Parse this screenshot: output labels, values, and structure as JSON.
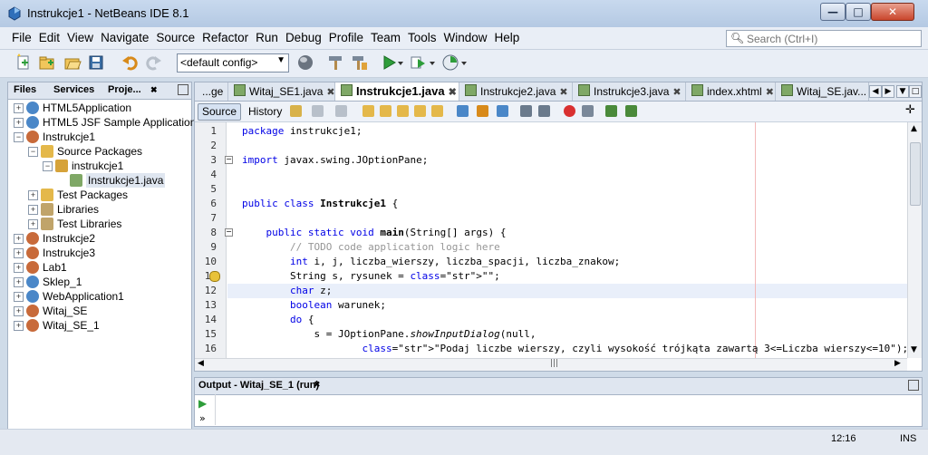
{
  "window": {
    "title": "Instrukcje1 - NetBeans IDE 8.1",
    "min_glyph": "—",
    "max_glyph": "□",
    "close_glyph": "✕"
  },
  "menu": [
    "File",
    "Edit",
    "View",
    "Navigate",
    "Source",
    "Refactor",
    "Run",
    "Debug",
    "Profile",
    "Team",
    "Tools",
    "Window",
    "Help"
  ],
  "search": {
    "placeholder": "Search (Ctrl+I)"
  },
  "toolbar": {
    "config": "<default config>"
  },
  "left_panel": {
    "tabs": [
      "Files",
      "Services",
      "Proje..."
    ],
    "close_glyph": "✖",
    "tree": [
      {
        "label": "HTML5Application",
        "depth": 0,
        "toggle": "+",
        "icon": "globe-icon"
      },
      {
        "label": "HTML5 JSF Sample Application",
        "depth": 0,
        "toggle": "+",
        "icon": "globe-icon"
      },
      {
        "label": "Instrukcje1",
        "depth": 0,
        "toggle": "−",
        "icon": "coffee-cup-icon"
      },
      {
        "label": "Source Packages",
        "depth": 1,
        "toggle": "−",
        "icon": "folder-icon"
      },
      {
        "label": "instrukcje1",
        "depth": 2,
        "toggle": "−",
        "icon": "package-icon"
      },
      {
        "label": "Instrukcje1.java",
        "depth": 3,
        "toggle": "",
        "icon": "java-file-icon",
        "selected": true
      },
      {
        "label": "Test Packages",
        "depth": 1,
        "toggle": "+",
        "icon": "folder-icon"
      },
      {
        "label": "Libraries",
        "depth": 1,
        "toggle": "+",
        "icon": "library-icon"
      },
      {
        "label": "Test Libraries",
        "depth": 1,
        "toggle": "+",
        "icon": "library-icon"
      },
      {
        "label": "Instrukcje2",
        "depth": 0,
        "toggle": "+",
        "icon": "coffee-cup-icon"
      },
      {
        "label": "Instrukcje3",
        "depth": 0,
        "toggle": "+",
        "icon": "coffee-cup-icon"
      },
      {
        "label": "Lab1",
        "depth": 0,
        "toggle": "+",
        "icon": "coffee-cup-icon"
      },
      {
        "label": "Sklep_1",
        "depth": 0,
        "toggle": "+",
        "icon": "globe-icon"
      },
      {
        "label": "WebApplication1",
        "depth": 0,
        "toggle": "+",
        "icon": "globe-icon"
      },
      {
        "label": "Witaj_SE",
        "depth": 0,
        "toggle": "+",
        "icon": "coffee-cup-icon"
      },
      {
        "label": "Witaj_SE_1",
        "depth": 0,
        "toggle": "+",
        "icon": "coffee-cup-icon"
      }
    ]
  },
  "editor": {
    "tabs": [
      {
        "label": "...ge",
        "active": false
      },
      {
        "label": "Witaj_SE1.java",
        "active": false
      },
      {
        "label": "Instrukcje1.java",
        "active": true
      },
      {
        "label": "Instrukcje2.java",
        "active": false
      },
      {
        "label": "Instrukcje3.java",
        "active": false
      },
      {
        "label": "index.xhtml",
        "active": false
      },
      {
        "label": "Witaj_SE.jav...",
        "active": false
      }
    ],
    "tab_close_glyph": "✖",
    "source_label": "Source",
    "history_label": "History",
    "lines": [
      {
        "n": "1",
        "code": "package instrukcje1;"
      },
      {
        "n": "2",
        "code": ""
      },
      {
        "n": "3",
        "code": "import javax.swing.JOptionPane;"
      },
      {
        "n": "4",
        "code": ""
      },
      {
        "n": "5",
        "code": ""
      },
      {
        "n": "6",
        "code": "public class Instrukcje1 {"
      },
      {
        "n": "7",
        "code": ""
      },
      {
        "n": "8",
        "code": "    public static void main(String[] args) {"
      },
      {
        "n": "9",
        "code": "        // TODO code application logic here"
      },
      {
        "n": "10",
        "code": "        int i, j, liczba_wierszy, liczba_spacji, liczba_znakow;"
      },
      {
        "n": "11",
        "code": "        String s, rysunek = \"\";"
      },
      {
        "n": "12",
        "code": "        char z;"
      },
      {
        "n": "13",
        "code": "        boolean warunek;"
      },
      {
        "n": "14",
        "code": "        do {"
      },
      {
        "n": "15",
        "code": "            s = JOptionPane.showInputDialog(null,"
      },
      {
        "n": "16",
        "code": "                    \"Podaj liczbe wierszy, czyli wysokość trójkąta zawartą 3<=Liczba wierszy<=10\");"
      }
    ],
    "hscroll_glyph": "|||"
  },
  "output": {
    "title": "Output - Witaj_SE_1 (run)",
    "close_glyph": "✖",
    "run_glyph": "▶",
    "more_glyph": "»"
  },
  "status": {
    "position": "12:16",
    "mode": "INS"
  }
}
